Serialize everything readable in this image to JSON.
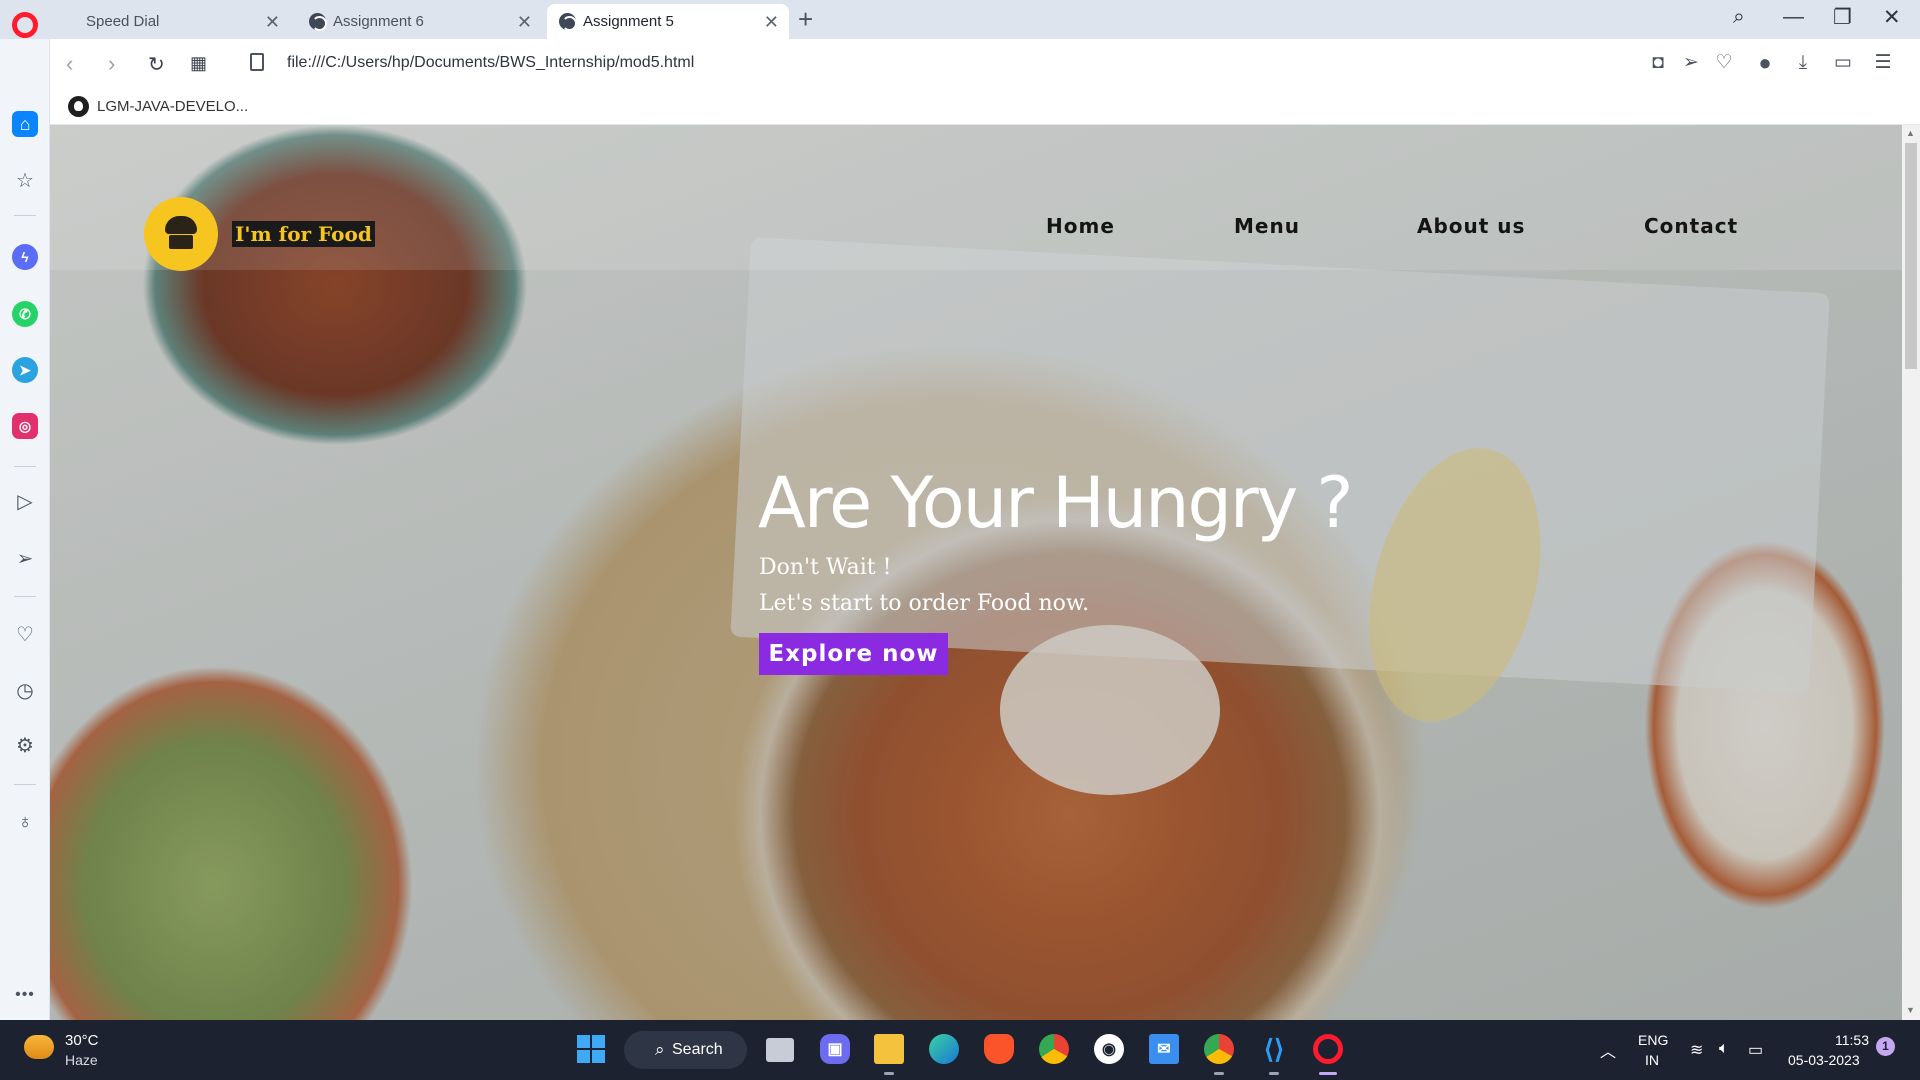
{
  "browser": {
    "tabs": [
      {
        "label": "Speed Dial",
        "icon": "grid-icon",
        "active": false
      },
      {
        "label": "Assignment 6",
        "icon": "globe-icon",
        "active": false
      },
      {
        "label": "Assignment 5",
        "icon": "globe-icon",
        "active": true
      }
    ],
    "url": "file:///C:/Users/hp/Documents/BWS_Internship/mod5.html",
    "bookmark": {
      "label": "LGM-JAVA-DEVELO...",
      "icon": "github-icon"
    }
  },
  "site": {
    "brand": "I'm for Food",
    "nav": [
      "Home",
      "Menu",
      "About us",
      "Contact"
    ],
    "hero": {
      "title": "Are Your Hungry ?",
      "line1": "Don't Wait !",
      "line2": "Let's start to order Food now.",
      "cta": "Explore now"
    },
    "colors": {
      "brand_yellow": "#f7c51f",
      "cta_purple": "#8a2be2"
    }
  },
  "taskbar": {
    "weather": {
      "temp": "30°C",
      "desc": "Haze"
    },
    "search": "Search",
    "lang_top": "ENG",
    "lang_bottom": "IN",
    "time": "11:53",
    "date": "05-03-2023",
    "notifications": "1"
  }
}
